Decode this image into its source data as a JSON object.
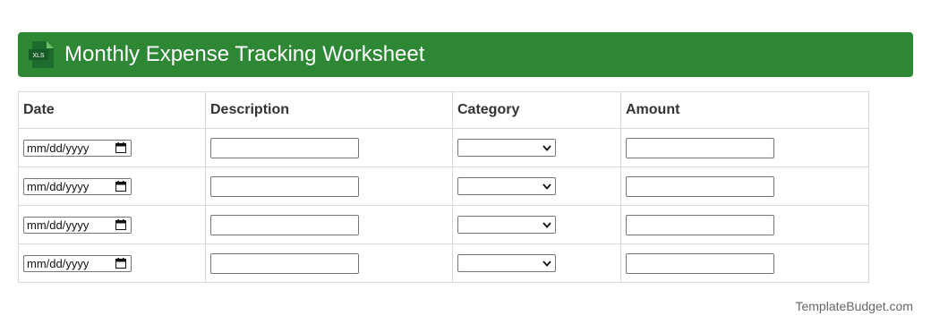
{
  "header": {
    "icon": "xls-file-icon",
    "icon_text": "XLS",
    "title": "Monthly Expense Tracking Worksheet",
    "background": "#2e8734"
  },
  "table": {
    "columns": [
      "Date",
      "Description",
      "Category",
      "Amount"
    ],
    "rows": [
      {
        "date_placeholder": "mm/dd/yyyy",
        "description": "",
        "category": "",
        "amount": ""
      },
      {
        "date_placeholder": "mm/dd/yyyy",
        "description": "",
        "category": "",
        "amount": ""
      },
      {
        "date_placeholder": "mm/dd/yyyy",
        "description": "",
        "category": "",
        "amount": ""
      },
      {
        "date_placeholder": "mm/dd/yyyy",
        "description": "",
        "category": "",
        "amount": ""
      }
    ]
  },
  "footer": {
    "credit": "TemplateBudget.com"
  }
}
